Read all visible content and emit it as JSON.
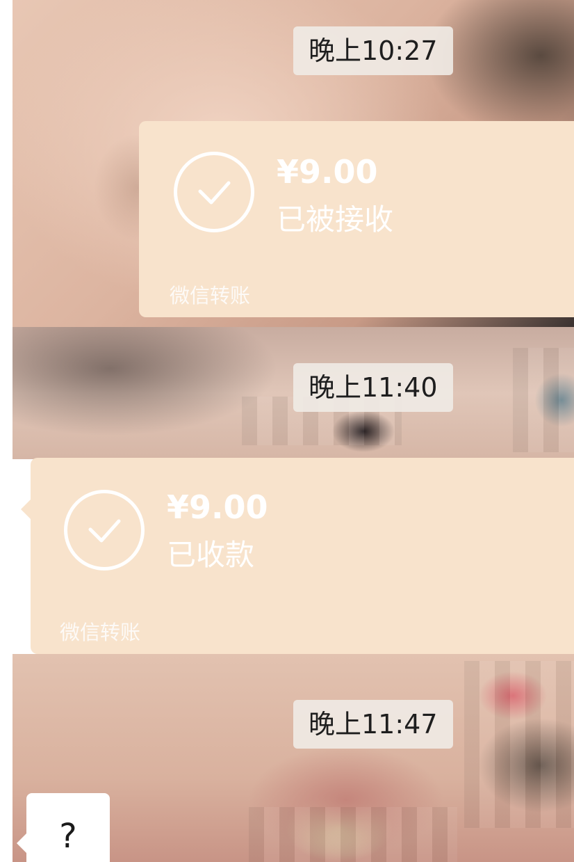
{
  "timestamps": [
    "晚上10:27",
    "晚上11:40",
    "晚上11:47"
  ],
  "transfers": [
    {
      "amount": "¥9.00",
      "status": "已被接收",
      "label": "微信转账",
      "direction": "outgoing"
    },
    {
      "amount": "¥9.00",
      "status": "已收款",
      "label": "微信转账",
      "direction": "incoming"
    }
  ],
  "reply_message": {
    "text": "?"
  },
  "colors": {
    "transfer_card": "#f8e3cc",
    "card_text": "#ffffff",
    "time_badge": "#f0ebe6"
  },
  "icons": {
    "transfer_status": "check-circle-icon"
  }
}
